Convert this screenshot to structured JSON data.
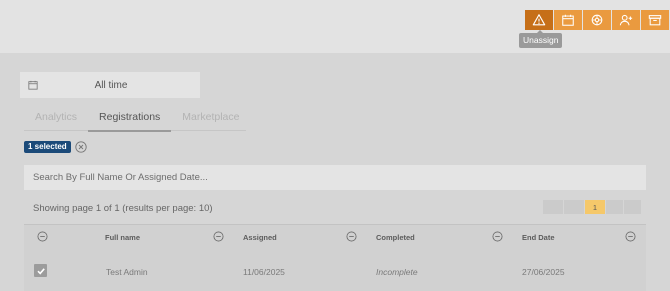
{
  "toolbar": {
    "buttons": [
      {
        "icon": "warning-icon",
        "active": true
      },
      {
        "icon": "calendar-icon",
        "active": false
      },
      {
        "icon": "settings-cog-icon",
        "active": false
      },
      {
        "icon": "add-user-icon",
        "active": false
      },
      {
        "icon": "archive-icon",
        "active": false
      }
    ],
    "tooltip": "Unassign",
    "accent_color": "#ea9a3f",
    "active_color": "#c66f18"
  },
  "date_filter": {
    "value": "All time"
  },
  "tabs": [
    {
      "label": "Analytics",
      "active": false
    },
    {
      "label": "Registrations",
      "active": true
    },
    {
      "label": "Marketplace",
      "active": false
    }
  ],
  "selection": {
    "badge": "1 selected",
    "badge_color": "#1b4a79"
  },
  "search": {
    "placeholder": "Search By Full Name Or Assigned Date..."
  },
  "paging": {
    "info": "Showing page 1 of 1 (results per page: 10)",
    "current_page": "1"
  },
  "table": {
    "columns": [
      "Full name",
      "Assigned",
      "Completed",
      "End Date"
    ],
    "rows": [
      {
        "checked": true,
        "full_name": "Test Admin",
        "assigned": "11/06/2025",
        "completed": "Incomplete",
        "end_date": "27/06/2025"
      }
    ]
  }
}
